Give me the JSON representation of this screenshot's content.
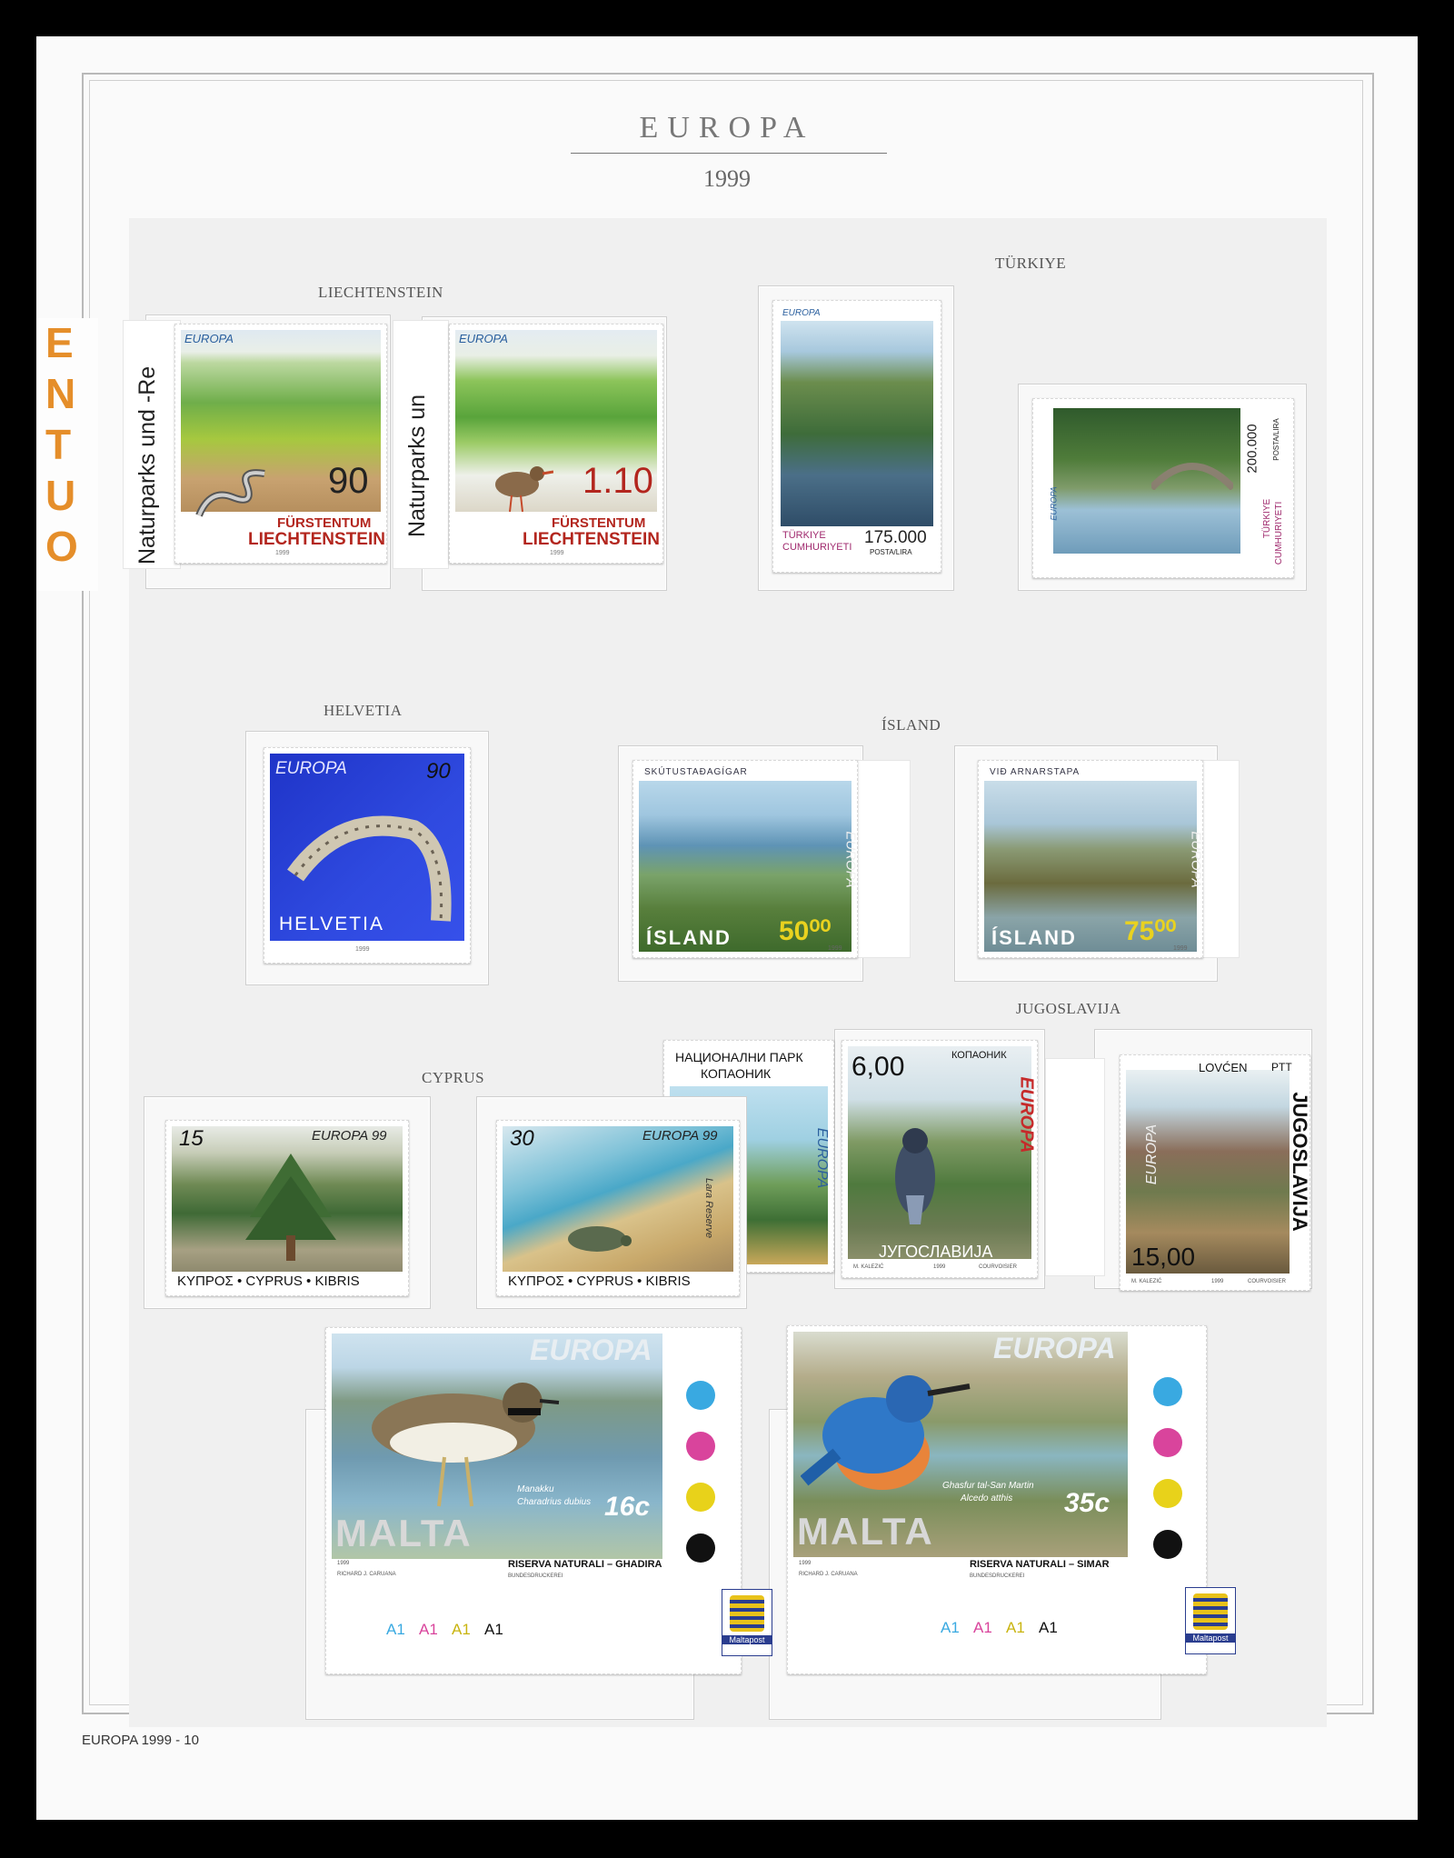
{
  "header": {
    "title": "EUROPA",
    "year": "1999"
  },
  "footer": "EUROPA 1999 - 10",
  "countries": {
    "liechtenstein": "LIECHTENSTEIN",
    "turkiye": "TÜRKIYE",
    "helvetia": "HELVETIA",
    "island": "ÍSLAND",
    "jugoslavija": "JUGOSLAVIJA",
    "cyprus": "CYPRUS"
  },
  "edge_strip": {
    "letters": [
      "E",
      "N",
      "T",
      "U",
      "O"
    ]
  },
  "liechtenstein": {
    "sheet_margin_1": "Naturparks und -Re",
    "sheet_margin_2": "Naturparks un",
    "stamps": [
      {
        "europa": "EUROPA",
        "value": "90",
        "line1": "FÜRSTENTUM",
        "line2": "LIECHTENSTEIN",
        "year": "1999"
      },
      {
        "europa": "EUROPA",
        "value": "1.10",
        "line1": "FÜRSTENTUM",
        "line2": "LIECHTENSTEIN",
        "year": "1999"
      }
    ]
  },
  "turkiye": {
    "stamps": [
      {
        "europa": "EUROPA",
        "country1": "TÜRKIYE",
        "country2": "CUMHURIYETI",
        "value": "175.000",
        "unit": "POSTA/LIRA"
      },
      {
        "europa": "EUROPA",
        "country1": "TÜRKIYE",
        "country2": "CUMHURIYETI",
        "value": "200.000",
        "unit": "POSTA/LIRA"
      }
    ]
  },
  "helvetia": {
    "stamp": {
      "europa": "EUROPA",
      "value": "90",
      "country": "HELVETIA",
      "year": "1999"
    }
  },
  "island": {
    "stamps": [
      {
        "place": "SKÚTUSTAÐAGÍGAR",
        "europa": "EUROPA",
        "country": "ÍSLAND",
        "value": "50⁰⁰",
        "year": "1999"
      },
      {
        "place": "VIÐ ARNARSTAPA",
        "europa": "EUROPA",
        "country": "ÍSLAND",
        "value": "75⁰⁰",
        "year": "1999"
      }
    ]
  },
  "jugoslavija": {
    "stamps": [
      {
        "top": "НАЦИОНАЛНИ ПАРК",
        "top2": "КОПАОНИК",
        "europa": "EUROPA"
      },
      {
        "value": "6,00",
        "top": "КОПАОНИК",
        "europa": "EUROPA",
        "country": "ЈУГОСЛАВИЈА",
        "designer": "M. KALEZIĆ",
        "year": "1999",
        "printer": "COURVOISIER"
      },
      {
        "top": "LOVĆEN",
        "ptt": "PTT",
        "europa": "EUROPA",
        "country": "JUGOSLAVIJA",
        "value": "15,00",
        "designer": "M. KALEZIĆ",
        "year": "1999",
        "printer": "COURVOISIER"
      }
    ]
  },
  "cyprus": {
    "stamps": [
      {
        "value": "15",
        "europa": "EUROPA 99",
        "country": "ΚΥΠΡΟΣ • CYPRUS • KIBRIS"
      },
      {
        "value": "30",
        "europa": "EUROPA 99",
        "reserve": "Lara Reserve",
        "country": "ΚΥΠΡΟΣ • CYPRUS • KIBRIS"
      }
    ]
  },
  "malta": {
    "stamps": [
      {
        "europa": "EUROPA",
        "country": "MALTA",
        "value": "16c",
        "species1": "Manakku",
        "species2": "Charadrius dubius",
        "reserve": "RISERVA NATURALI – GHADIRA",
        "designer": "RICHARD J. CARUANA",
        "printer": "BUNDESDRUCKEREI",
        "year": "1999",
        "plate": [
          "A1",
          "A1",
          "A1",
          "A1"
        ],
        "logo": "Maltapost"
      },
      {
        "europa": "EUROPA",
        "country": "MALTA",
        "value": "35c",
        "species1": "Ghasfur tal-San Martin",
        "species2": "Alcedo atthis",
        "reserve": "RISERVA NATURALI – SIMAR",
        "designer": "RICHARD J. CARUANA",
        "printer": "BUNDESDRUCKEREI",
        "year": "1999",
        "plate": [
          "A1",
          "A1",
          "A1",
          "A1"
        ],
        "logo": "Maltapost"
      }
    ],
    "plate_colors": [
      "#39a9e1",
      "#d9449c",
      "#e8d21a",
      "#111111"
    ]
  }
}
